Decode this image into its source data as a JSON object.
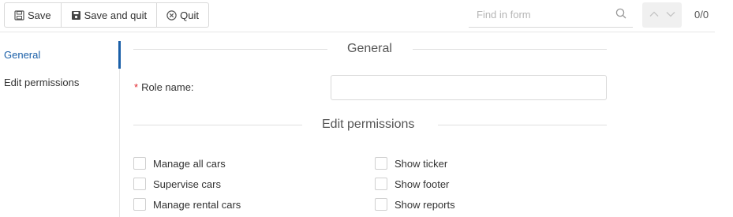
{
  "toolbar": {
    "save_label": "Save",
    "save_quit_label": "Save and quit",
    "quit_label": "Quit"
  },
  "search": {
    "placeholder": "Find in form",
    "counter": "0/0"
  },
  "sidebar": {
    "items": [
      {
        "label": "General",
        "active": true
      },
      {
        "label": "Edit permissions",
        "active": false
      }
    ]
  },
  "form": {
    "general_title": "General",
    "role_name_required_marker": "*",
    "role_name_label": "Role name:",
    "role_name_value": "",
    "permissions_title": "Edit permissions",
    "permissions": [
      {
        "label": "Manage all cars",
        "checked": false
      },
      {
        "label": "Supervise cars",
        "checked": false
      },
      {
        "label": "Manage rental cars",
        "checked": false
      },
      {
        "label": "Show ticker",
        "checked": false
      },
      {
        "label": "Show footer",
        "checked": false
      },
      {
        "label": "Show reports",
        "checked": false
      }
    ]
  },
  "colors": {
    "accent": "#1a5fa8",
    "required": "#e0262d",
    "border": "#d9d9d9"
  },
  "icons": {
    "save": "floppy-disk-icon",
    "save_quit": "floppy-disk-filled-icon",
    "quit": "close-circle-icon",
    "search": "search-icon",
    "prev": "chevron-up-icon",
    "next": "chevron-down-icon"
  }
}
